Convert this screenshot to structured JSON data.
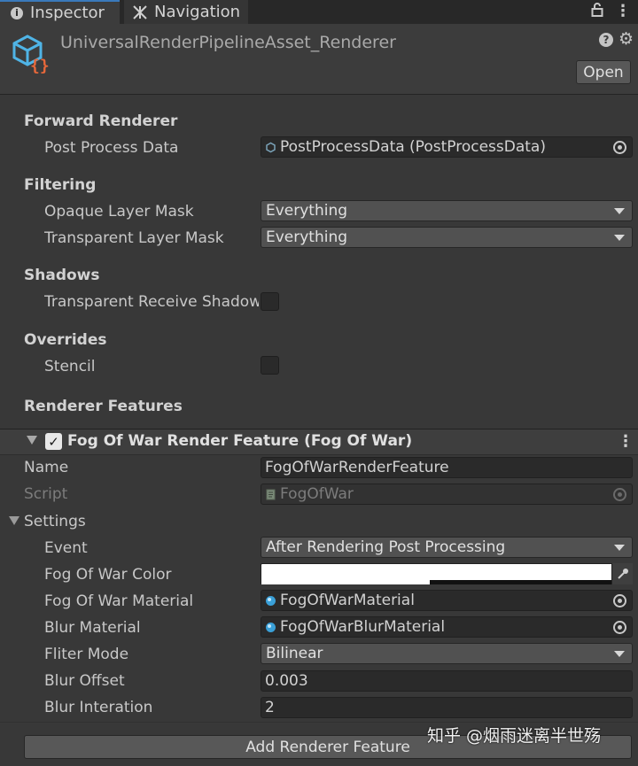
{
  "tabs": {
    "inspector": "Inspector",
    "navigation": "Navigation"
  },
  "icons": {
    "inspector_tab": "info-icon",
    "navigation_tab": "navigation-icon",
    "lock": "lock-icon",
    "menu": "kebab-icon",
    "asset": "script-asset-icon",
    "help": "help-icon",
    "settings": "gear-icon"
  },
  "header": {
    "title": "UniversalRenderPipelineAsset_Renderer",
    "open_label": "Open"
  },
  "forward_renderer": {
    "heading": "Forward Renderer",
    "post_process_label": "Post Process Data",
    "post_process_value": "PostProcessData (PostProcessData)"
  },
  "filtering": {
    "heading": "Filtering",
    "opaque_label": "Opaque Layer Mask",
    "opaque_value": "Everything",
    "transparent_label": "Transparent Layer Mask",
    "transparent_value": "Everything"
  },
  "shadows": {
    "heading": "Shadows",
    "receive_label": "Transparent Receive Shadows",
    "receive_checked": false
  },
  "overrides": {
    "heading": "Overrides",
    "stencil_label": "Stencil",
    "stencil_checked": false
  },
  "renderer_features": {
    "heading": "Renderer Features",
    "feature_title": "Fog Of War Render Feature (Fog Of War)",
    "feature_enabled": true,
    "name_label": "Name",
    "name_value": "FogOfWarRenderFeature",
    "script_label": "Script",
    "script_value": "FogOfWar",
    "settings_label": "Settings",
    "event_label": "Event",
    "event_value": "After Rendering Post Processing",
    "color_label": "Fog Of War Color",
    "color_value": "#ffffff",
    "color_alpha": 0.48,
    "material_label": "Fog Of War Material",
    "material_value": "FogOfWarMaterial",
    "blur_material_label": "Blur Material",
    "blur_material_value": "FogOfWarBlurMaterial",
    "filter_label": "Fliter Mode",
    "filter_value": "Bilinear",
    "blur_offset_label": "Blur Offset",
    "blur_offset_value": "0.003",
    "blur_iteration_label": "Blur Interation",
    "blur_iteration_value": "2"
  },
  "add_feature_label": "Add Renderer Feature",
  "watermark": "知乎 @烟雨迷离半世殇"
}
